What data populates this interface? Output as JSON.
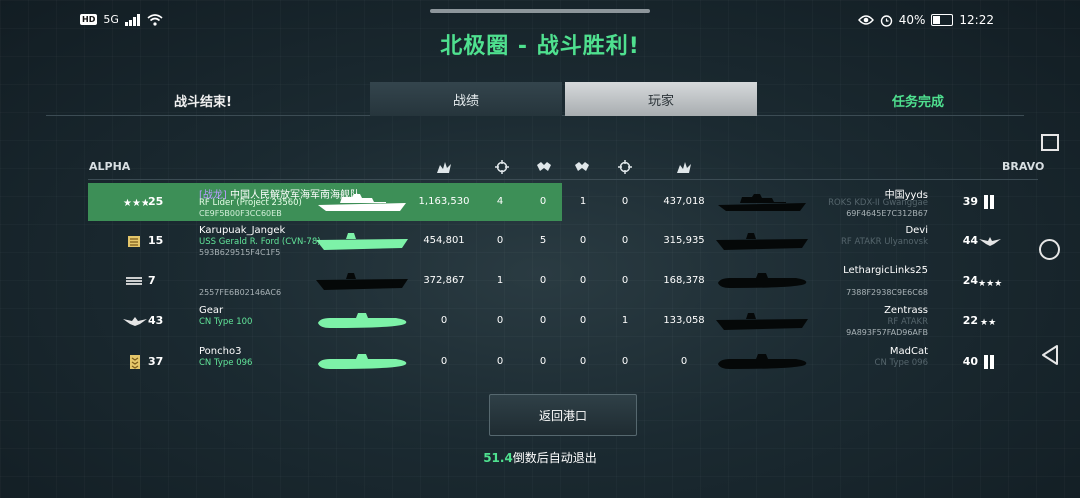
{
  "status_bar": {
    "signal": "5G",
    "battery": "40%",
    "battery_level": 0.4,
    "time": "12:22"
  },
  "title": "北极圈 - 战斗胜利!",
  "tabs": {
    "left_label": "战斗结束!",
    "stats_label": "战绩",
    "players_label": "玩家",
    "right_label": "任务完成"
  },
  "teams": {
    "left": "ALPHA",
    "right": "BRAVO"
  },
  "rows": [
    {
      "left": {
        "level": "25",
        "clan": "[战龙]",
        "name": "中国人民解放军海军南海舰队",
        "ship": "RF Lider (Project 23560)",
        "id": "CE9F5B00F3CC60EB"
      },
      "stats": [
        "1,163,530",
        "4",
        "0",
        "1",
        "0",
        "437,018"
      ],
      "right": {
        "name": "中国yyds",
        "ship": "ROKS KDX-II Gwanggae",
        "id": "69F4645E7C312B67",
        "level": "39"
      }
    },
    {
      "left": {
        "level": "15",
        "clan": "",
        "name": "Karupuak_Jangek",
        "ship": "USS Gerald R. Ford (CVN-78)",
        "id": "593B629515F4C1F5"
      },
      "stats": [
        "454,801",
        "0",
        "5",
        "0",
        "0",
        "315,935"
      ],
      "right": {
        "name": "Devi",
        "ship": "RF ATAKR Ulyanovsk",
        "id": "",
        "level": "44"
      }
    },
    {
      "left": {
        "level": "7",
        "clan": "",
        "name": "",
        "ship": "",
        "id": "2557FE6B02146AC6"
      },
      "stats": [
        "372,867",
        "1",
        "0",
        "0",
        "0",
        "168,378"
      ],
      "right": {
        "name": "LethargicLinks25",
        "ship": "",
        "id": "7388F2938C9E6C68",
        "level": "24"
      }
    },
    {
      "left": {
        "level": "43",
        "clan": "",
        "name": "Gear",
        "ship": "CN Type 100",
        "id": ""
      },
      "stats": [
        "0",
        "0",
        "0",
        "0",
        "1",
        "133,058"
      ],
      "right": {
        "name": "Zentrass",
        "ship": "RF ATAKR",
        "id": "9A893F57FAD96AFB",
        "level": "22"
      }
    },
    {
      "left": {
        "level": "37",
        "clan": "",
        "name": "Poncho3",
        "ship": "CN Type 096",
        "id": ""
      },
      "stats": [
        "0",
        "0",
        "0",
        "0",
        "0",
        "0"
      ],
      "right": {
        "name": "MadCat",
        "ship": "CN Type 096",
        "id": "",
        "level": "40"
      }
    }
  ],
  "buttons": {
    "return_port": "返回港口"
  },
  "countdown": {
    "seconds": "51.4",
    "text": "倒数后自动退出"
  },
  "colors": {
    "accent_green": "#4fe08f",
    "highlight_row": "#3d8f57",
    "ship_green": "#7df2a8"
  }
}
